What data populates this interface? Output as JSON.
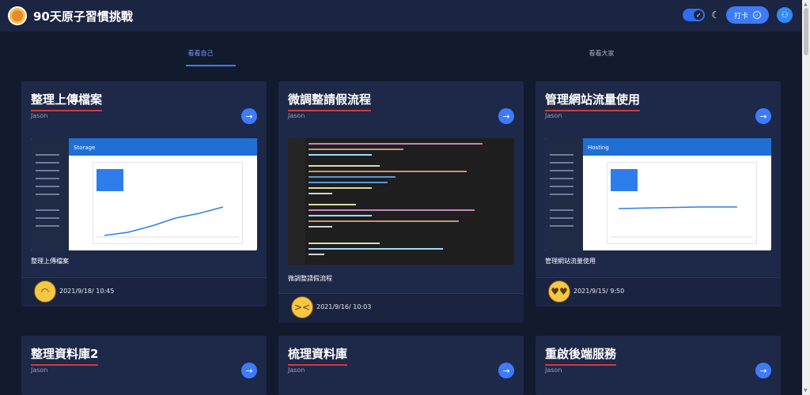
{
  "app": {
    "title": "90天原子習慣挑戰"
  },
  "header": {
    "checkin_label": "打卡",
    "theme_toggle_icon": "check-icon",
    "moon_icon": "moon-icon",
    "user_icon": "user-icon"
  },
  "tabs": [
    {
      "label": "看看自己",
      "active": true
    },
    {
      "label": "看看大家",
      "active": false
    }
  ],
  "colors": {
    "accent": "#3d7bff",
    "underline": "#d23b3b",
    "background": "#121a2e",
    "card": "#1e2848"
  },
  "cards": [
    {
      "title": "整理上傳檔案",
      "author": "Jason",
      "caption": "整理上傳檔案",
      "date": "2021/9/18/ 10:45",
      "emoji": "upside-down-face",
      "thumb": "firebase-storage",
      "thumb_heading": "Storage"
    },
    {
      "title": "微調整請假流程",
      "author": "Jason",
      "caption": "微調整請假流程",
      "date": "2021/9/16/ 10:03",
      "emoji": "tired-face",
      "thumb": "code-editor"
    },
    {
      "title": "管理網站流量使用",
      "author": "Jason",
      "caption": "管理網站流量使用",
      "date": "2021/9/15/ 9:50",
      "emoji": "heart-eyes-face",
      "thumb": "firebase-hosting",
      "thumb_heading": "Hosting"
    },
    {
      "title": "整理資料庫2",
      "author": "Jason"
    },
    {
      "title": "梳理資料庫",
      "author": "Jason"
    },
    {
      "title": "重啟後端服務",
      "author": "Jason"
    }
  ]
}
